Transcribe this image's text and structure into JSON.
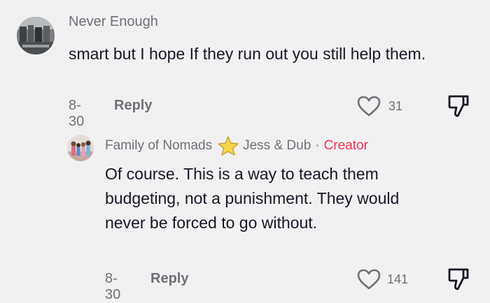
{
  "comment": {
    "author": "Never Enough",
    "text": "smart but I hope If they run out you still help them.",
    "date": "8-30",
    "reply_label": "Reply",
    "likes": "31",
    "avatar_icon": "group-photo-avatar"
  },
  "reply": {
    "author": "Family of Nomads",
    "badge_icon": "star-icon",
    "handle": "Jess & Dub",
    "separator": "·",
    "role": "Creator",
    "text": "Of course. This is a way to teach them budgeting, not a punishment. They would never be forced to go without.",
    "date": "8-30",
    "reply_label": "Reply",
    "likes": "141",
    "avatar_icon": "family-photo-avatar"
  },
  "colors": {
    "background": "#f1f1f2",
    "text": "#161823",
    "secondary": "#6f7077",
    "creator": "#fe2c55",
    "star": "#f7d54a"
  }
}
